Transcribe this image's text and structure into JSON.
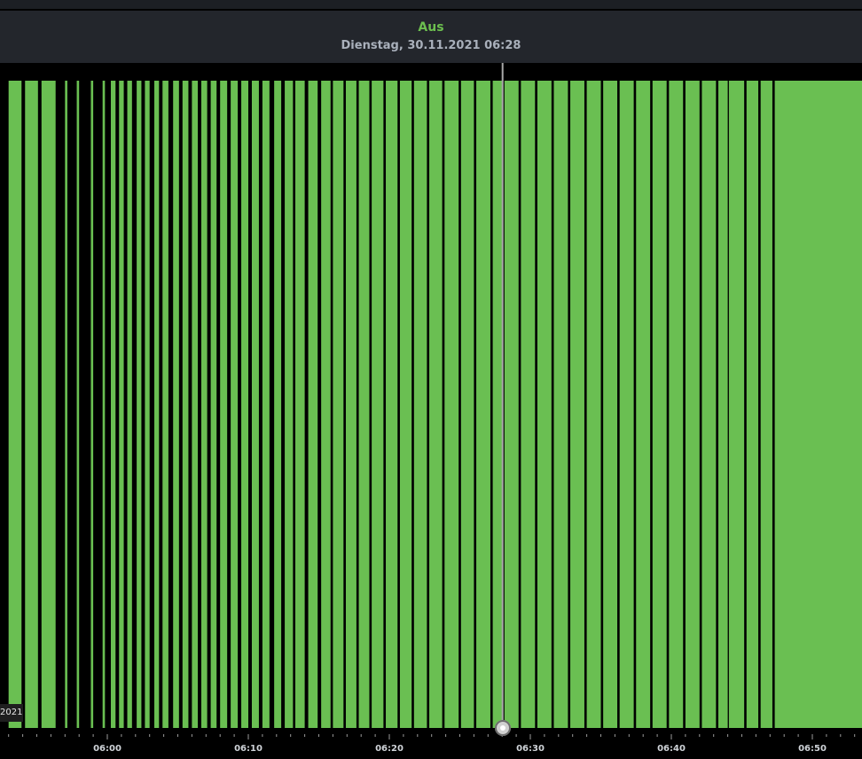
{
  "tooltip": {
    "state": "Aus",
    "datetime": "Dienstag, 30.11.2021 06:28"
  },
  "date_badge": "2021",
  "colors": {
    "on": "#6abf52",
    "off": "#000000",
    "header_bg": "#23262c",
    "state_text": "#6cbf4f"
  },
  "chart_data": {
    "type": "timeline",
    "x_unit": "minutes",
    "x_ticks": [
      "06:00",
      "06:10",
      "06:20",
      "06:30",
      "06:40",
      "06:50"
    ],
    "cursor_time": "06:28",
    "on_intervals": [
      [
        "05:53:00",
        "05:53:55"
      ],
      [
        "05:54:10",
        "05:55:05"
      ],
      [
        "05:55:20",
        "05:56:20"
      ],
      [
        "05:57:00",
        "05:57:10"
      ],
      [
        "05:57:50",
        "05:58:00"
      ],
      [
        "05:58:50",
        "05:59:00"
      ],
      [
        "05:59:40",
        "05:59:50"
      ],
      [
        "06:00:15",
        "06:00:35"
      ],
      [
        "06:00:50",
        "06:01:10"
      ],
      [
        "06:01:25",
        "06:01:45"
      ],
      [
        "06:02:05",
        "06:02:25"
      ],
      [
        "06:02:40",
        "06:03:00"
      ],
      [
        "06:03:20",
        "06:03:40"
      ],
      [
        "06:03:55",
        "06:04:20"
      ],
      [
        "06:04:40",
        "06:05:05"
      ],
      [
        "06:05:20",
        "06:05:45"
      ],
      [
        "06:06:00",
        "06:06:25"
      ],
      [
        "06:06:40",
        "06:07:05"
      ],
      [
        "06:07:20",
        "06:07:45"
      ],
      [
        "06:08:00",
        "06:08:30"
      ],
      [
        "06:08:45",
        "06:09:15"
      ],
      [
        "06:09:30",
        "06:10:00"
      ],
      [
        "06:10:15",
        "06:10:45"
      ],
      [
        "06:11:00",
        "06:11:30"
      ],
      [
        "06:11:50",
        "06:12:20"
      ],
      [
        "06:12:35",
        "06:13:10"
      ],
      [
        "06:13:20",
        "06:14:00"
      ],
      [
        "06:14:15",
        "06:14:55"
      ],
      [
        "06:15:10",
        "06:15:50"
      ],
      [
        "06:16:00",
        "06:16:45"
      ],
      [
        "06:16:55",
        "06:17:40"
      ],
      [
        "06:17:50",
        "06:18:35"
      ],
      [
        "06:18:45",
        "06:19:35"
      ],
      [
        "06:19:45",
        "06:20:35"
      ],
      [
        "06:20:45",
        "06:21:35"
      ],
      [
        "06:21:45",
        "06:22:40"
      ],
      [
        "06:22:50",
        "06:23:45"
      ],
      [
        "06:23:55",
        "06:24:55"
      ],
      [
        "06:25:05",
        "06:26:00"
      ],
      [
        "06:26:10",
        "06:27:10"
      ],
      [
        "06:27:20",
        "06:28:00"
      ],
      [
        "06:28:10",
        "06:29:10"
      ],
      [
        "06:29:20",
        "06:30:20"
      ],
      [
        "06:30:30",
        "06:31:30"
      ],
      [
        "06:31:40",
        "06:32:40"
      ],
      [
        "06:32:50",
        "06:33:50"
      ],
      [
        "06:34:00",
        "06:35:00"
      ],
      [
        "06:35:10",
        "06:36:10"
      ],
      [
        "06:36:20",
        "06:37:20"
      ],
      [
        "06:37:30",
        "06:38:30"
      ],
      [
        "06:38:40",
        "06:39:40"
      ],
      [
        "06:39:50",
        "06:40:50"
      ],
      [
        "06:41:00",
        "06:42:00"
      ],
      [
        "06:42:10",
        "06:43:10"
      ],
      [
        "06:43:20",
        "06:44:00"
      ],
      [
        "06:44:05",
        "06:45:10"
      ],
      [
        "06:45:20",
        "06:46:10"
      ],
      [
        "06:46:20",
        "06:47:10"
      ],
      [
        "06:47:20",
        "06:54:00"
      ]
    ]
  }
}
